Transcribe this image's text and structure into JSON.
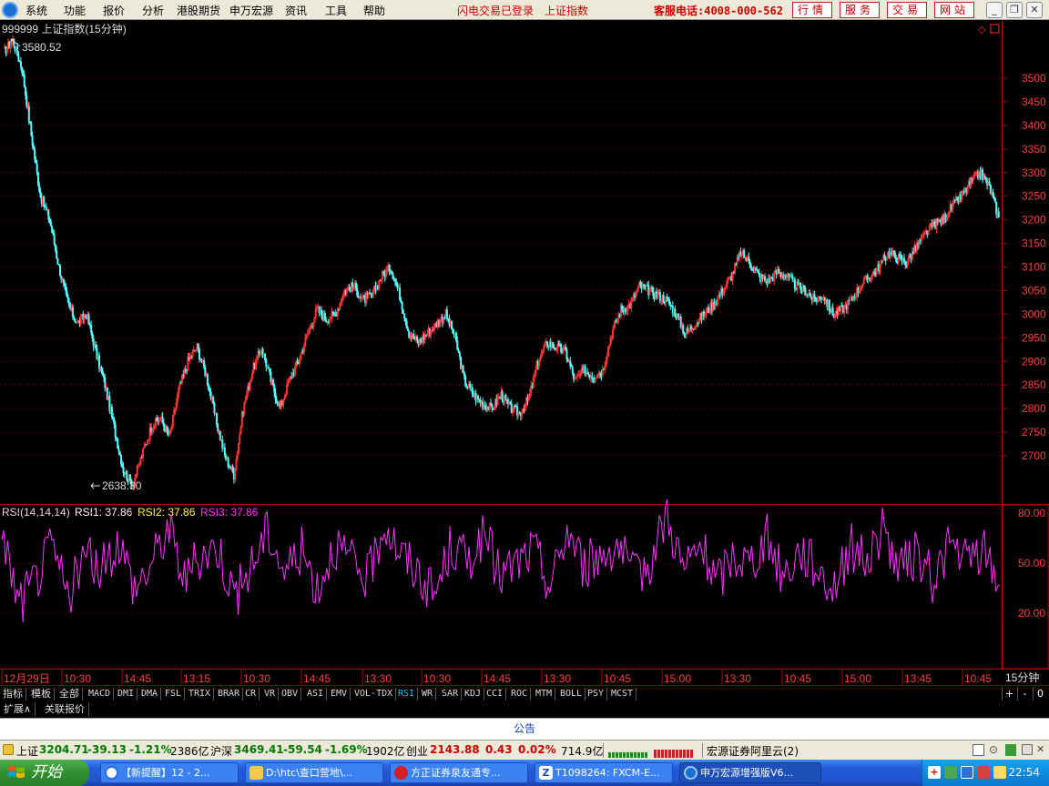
{
  "menubar": {
    "items": [
      "系统",
      "功能",
      "报价",
      "分析",
      "港股期货",
      "申万宏源",
      "资讯",
      "工具",
      "帮助"
    ],
    "login_status": "闪电交易已登录",
    "index_name": "上证指数",
    "phone": "客服电话:4008-000-562",
    "buttons": [
      "行情",
      "服务",
      "交易",
      "网站"
    ]
  },
  "chart": {
    "title": "999999 上证指数(15分钟)",
    "high_label": "3580.52",
    "low_label": "2638.30",
    "price_ticks": [
      "3500",
      "3450",
      "3400",
      "3350",
      "3300",
      "3250",
      "3200",
      "3150",
      "3100",
      "3050",
      "3000",
      "2950",
      "2900",
      "2850",
      "2800",
      "2750",
      "2700"
    ],
    "rsi_header": "RSI(14,14,14)",
    "rsi1_label": "RSI1: 37.86",
    "rsi2_label": "RSI2: 37.86",
    "rsi3_label": "RSI3: 37.86",
    "rsi_ticks": [
      "80.00",
      "50.00",
      "20.00"
    ],
    "time_labels": [
      "12月29日",
      "10:30",
      "14:45",
      "13:15",
      "10:30",
      "14:45",
      "13:30",
      "10:30",
      "14:45",
      "13:30",
      "10:45",
      "15:00",
      "13:30",
      "10:45",
      "15:00",
      "13:45",
      "10:45"
    ],
    "period_label": "15分钟",
    "colors": {
      "up": "#ff3232",
      "down": "#54ffff",
      "rsi": "#ff30ff",
      "axis": "#b00000",
      "grid": "#800000"
    }
  },
  "chart_data": {
    "type": "line",
    "title": "999999 上证指数(15分钟)",
    "series": [
      {
        "name": "",
        "values": [
          3555,
          3580.52,
          3520,
          3380,
          3250,
          3200,
          3100,
          3020,
          2980,
          3000,
          2920,
          2850,
          2760,
          2670,
          2638.3,
          2700,
          2760,
          2780,
          2740,
          2840,
          2900,
          2930,
          2870,
          2780,
          2700,
          2660,
          2800,
          2880,
          2930,
          2860,
          2800,
          2860,
          2900,
          2960,
          3010,
          2990,
          3000,
          3050,
          3060,
          3030,
          3040,
          3080,
          3100,
          3040,
          2960,
          2940,
          2960,
          2980,
          3000,
          2950,
          2860,
          2830,
          2810,
          2800,
          2830,
          2800,
          2790,
          2820,
          2900,
          2940,
          2930,
          2920,
          2860,
          2880,
          2870,
          2880,
          2960,
          3010,
          3020,
          3060,
          3050,
          3040,
          3030,
          3000,
          2960,
          2980,
          3000,
          3020,
          3050,
          3080,
          3130,
          3110,
          3080,
          3070,
          3090,
          3080,
          3060,
          3050,
          3030,
          3040,
          3000,
          3010,
          3030,
          3060,
          3080,
          3100,
          3130,
          3120,
          3110,
          3140,
          3170,
          3190,
          3200,
          3230,
          3250,
          3280,
          3300,
          3270,
          3205
        ]
      },
      {
        "name": "RSI1",
        "values": [
          70,
          25,
          40,
          60,
          30,
          55,
          45,
          65,
          35,
          50,
          72,
          40,
          55,
          60,
          30,
          48,
          70,
          45,
          58,
          35,
          62,
          50,
          40,
          75,
          55,
          45,
          30,
          60,
          52,
          66,
          42,
          50,
          58,
          36,
          70,
          48,
          55,
          62,
          40,
          52,
          80,
          45,
          60,
          38,
          55,
          50,
          65,
          42,
          58,
          48,
          35,
          60,
          52,
          70,
          45,
          55,
          40,
          62,
          50,
          58,
          37.86
        ]
      }
    ],
    "xlabel": "",
    "ylabel": "",
    "ylim": [
      2638.3,
      3580.52
    ],
    "categories": [
      "12月29日",
      "10:30",
      "14:45",
      "13:15",
      "10:30",
      "14:45",
      "13:30",
      "10:30",
      "14:45",
      "13:30",
      "10:45",
      "15:00",
      "13:30",
      "10:45",
      "15:00",
      "13:45",
      "10:45"
    ],
    "grid": true,
    "legend": "top-left"
  },
  "tabs": {
    "items": [
      "指标",
      "模板",
      "全部",
      "MACD",
      "DMI",
      "DMA",
      "FSL",
      "TRIX",
      "BRAR",
      "CR",
      "VR",
      "OBV",
      "ASI",
      "EMV",
      "VOL-TDX",
      "RSI",
      "WR",
      "SAR",
      "KDJ",
      "CCI",
      "ROC",
      "MTM",
      "BOLL",
      "PSY",
      "MCST"
    ],
    "active": "RSI",
    "controls": [
      "+",
      "-",
      "0"
    ]
  },
  "subtabs": [
    "扩展∧",
    "关联报价"
  ],
  "notice": "公告",
  "status": {
    "sh_label": "上证",
    "sh_value": "3204.71",
    "sh_change": "-39.13",
    "sh_pct": "-1.21%",
    "sh_amount": "2386亿",
    "hs_label": "沪深",
    "hs_value": "3469.41",
    "hs_change": "-59.54",
    "hs_pct": "-1.69%",
    "hs_amount": "1902亿",
    "cy_label": "创业",
    "cy_value": "2143.88",
    "cy_change": "0.43",
    "cy_pct": "0.02%",
    "cy_amount": "714.9亿",
    "server": "宏源证券阿里云(2)"
  },
  "taskbar": {
    "start": "开始",
    "items": [
      "【新提醒】12 - 2...",
      "D:\\htc\\查口营地\\...",
      "方正证券泉友通专...",
      "T1098264: FXCM-E...",
      "申万宏源增强版V6..."
    ],
    "clock": "22:54"
  }
}
